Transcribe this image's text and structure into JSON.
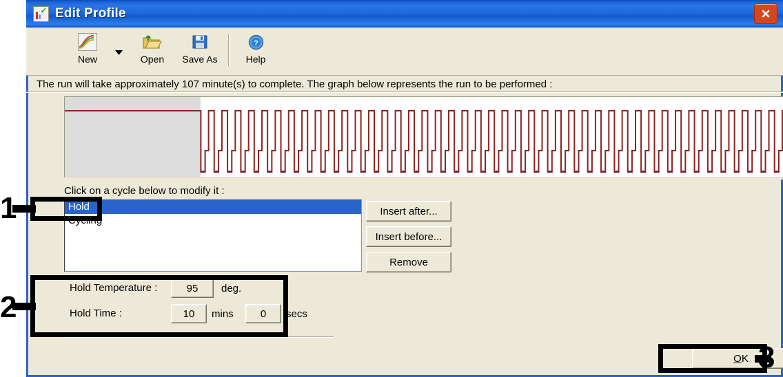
{
  "window": {
    "title": "Edit Profile",
    "app_icon": "profile-chart-icon",
    "close_icon": "close-icon"
  },
  "toolbar": {
    "items": [
      {
        "label": "New",
        "icon": "new-profile-icon"
      },
      {
        "label": "Open",
        "icon": "open-folder-icon"
      },
      {
        "label": "Save As",
        "icon": "floppy-disk-icon"
      },
      {
        "label": "Help",
        "icon": "question-mark-icon"
      }
    ],
    "dropdown_icon": "chevron-down-icon"
  },
  "info": {
    "text": "The run will take approximately 107 minute(s) to complete. The graph below represents the run to be performed :",
    "run_minutes": 107
  },
  "graph": {
    "title": "run-profile-graph",
    "hold_selected": true,
    "colors": {
      "trace": "#8b2424",
      "acquire": "#1a1a8c",
      "selection": "#dcdcdc",
      "background": "#ffffff"
    },
    "cycles": 45
  },
  "list": {
    "label": "Click on a cycle below to modify it :",
    "items": [
      {
        "label": "Hold",
        "selected": true
      },
      {
        "label": "Cycling",
        "selected": false
      }
    ]
  },
  "buttons": {
    "insert_after": "Insert after...",
    "insert_before": "Insert before...",
    "remove": "Remove",
    "ok": "OK",
    "ok_accelerator": "O"
  },
  "hold": {
    "temperature_label": "Hold Temperature :",
    "temperature_value": "95",
    "temperature_unit": "deg.",
    "time_label": "Hold Time :",
    "time_mins_value": "10",
    "time_mins_unit": "mins",
    "time_secs_value": "0",
    "time_secs_unit": "secs"
  },
  "annotations": [
    {
      "number": "1",
      "target": "list-item-hold"
    },
    {
      "number": "2",
      "target": "hold-parameters-panel"
    },
    {
      "number": "3",
      "target": "ok-button"
    }
  ]
}
